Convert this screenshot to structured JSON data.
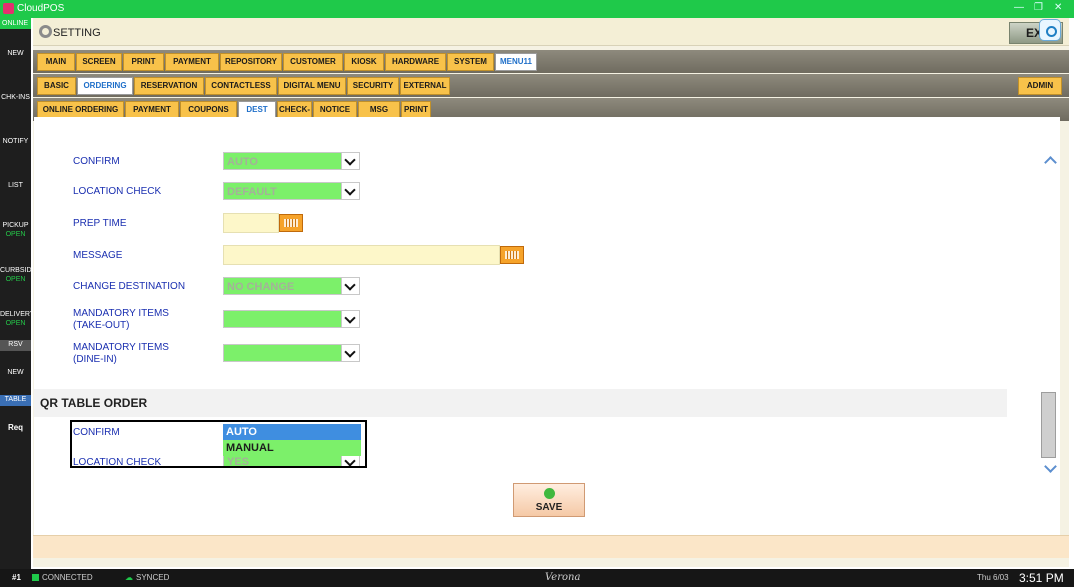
{
  "window": {
    "app_title": "CloudPOS"
  },
  "rail": {
    "online": "ONLINE",
    "items": [
      {
        "label": "NEW"
      },
      {
        "label": "CHK-INS"
      },
      {
        "label": "NOTIFY"
      },
      {
        "label": "LIST"
      },
      {
        "label": "PICKUP",
        "sub": "OPEN"
      },
      {
        "label": "CURBSIDE",
        "sub": "OPEN"
      },
      {
        "label": "DELIVERY",
        "sub": "OPEN"
      },
      {
        "label": "RSV"
      },
      {
        "label": "NEW"
      },
      {
        "label": "TABLE"
      },
      {
        "label": "Req"
      }
    ]
  },
  "header": {
    "title": "SETTING",
    "exit_label": "EXIT"
  },
  "tabs_main": [
    "MAIN",
    "SCREEN",
    "PRINT",
    "PAYMENT",
    "REPOSITORY",
    "CUSTOMER",
    "KIOSK",
    "HARDWARE",
    "SYSTEM",
    "MENU11"
  ],
  "tabs_main_active": "MENU11",
  "tabs_sub": [
    "BASIC",
    "ORDERING",
    "RESERVATION",
    "CONTACTLESS",
    "DIGITAL MENU",
    "SECURITY",
    "EXTERNAL"
  ],
  "tabs_sub_active": "ORDERING",
  "admin_label": "ADMIN",
  "tabs_third": [
    "ONLINE ORDERING",
    "PAYMENT",
    "COUPONS",
    "DEST",
    "CHECK-IN",
    "NOTICE",
    "MSG",
    "PRINT"
  ],
  "tabs_third_active": "DEST",
  "form": {
    "confirm": {
      "label": "CONFIRM",
      "value": "AUTO"
    },
    "location_check": {
      "label": "LOCATION CHECK",
      "value": "DEFAULT"
    },
    "prep_time": {
      "label": "PREP TIME",
      "value": ""
    },
    "message": {
      "label": "MESSAGE",
      "value": ""
    },
    "change_destination": {
      "label": "CHANGE DESTINATION",
      "value": "NO CHANGE"
    },
    "mandatory_takeout": {
      "label_line1": "MANDATORY ITEMS",
      "label_line2": "(TAKE-OUT)",
      "value": ""
    },
    "mandatory_dinein": {
      "label_line1": "MANDATORY ITEMS",
      "label_line2": "(DINE-IN)",
      "value": ""
    }
  },
  "qr_section": {
    "title": "QR TABLE ORDER",
    "confirm_label": "CONFIRM",
    "location_check_label": "LOCATION CHECK",
    "location_check_value": "YES",
    "dropdown_options": [
      "AUTO",
      "MANUAL"
    ],
    "dropdown_selected": "AUTO"
  },
  "save_label": "SAVE",
  "status": {
    "terminal": "#1",
    "connected": "CONNECTED",
    "synced": "SYNCED",
    "location": "Verona",
    "date": "Thu 6/03",
    "time": "3:51 PM"
  },
  "colors": {
    "accent_green": "#1fc94a",
    "tab_orange": "#f8c24a",
    "field_green": "#7cf06a",
    "field_yellow": "#fdf7c9",
    "label_blue": "#1a2fb0"
  }
}
